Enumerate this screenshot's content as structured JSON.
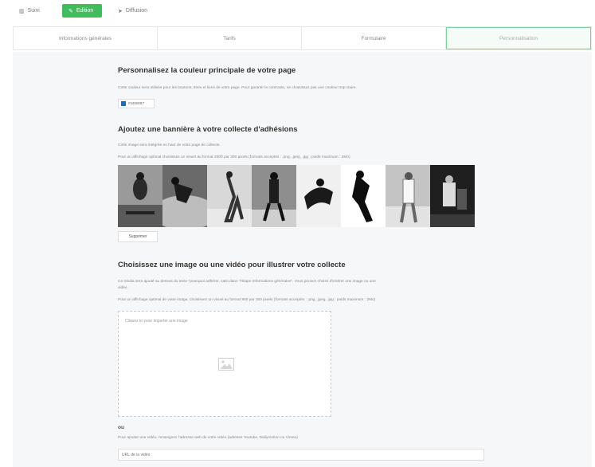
{
  "nav": {
    "suivi": {
      "icon": "chart-icon",
      "label": "Suivi"
    },
    "edition": {
      "icon": "pencil-icon",
      "label": "Edition"
    },
    "diffusion": {
      "icon": "send-icon",
      "label": "Diffusion"
    }
  },
  "tabs": [
    {
      "label": "Informations générales"
    },
    {
      "label": "Tarifs"
    },
    {
      "label": "Formulaire"
    },
    {
      "label": "Personnalisation"
    }
  ],
  "color_section": {
    "title": "Personnalisez la couleur principale de votre page",
    "description": "Cette couleur sera utilisée pour les boutons, titres et liens de votre page. Pour garantir le contraste, ne choisissez pas une couleur trop claire.",
    "color_value": "#1E6EB7",
    "color_hex": "#1e6fb8"
  },
  "banner_section": {
    "title": "Ajoutez une bannière à votre collecte d'adhésions",
    "description": "Cette image sera intégrée en haut de votre page de collecte.",
    "hint": "Pour un affichage optimal choisissez un visuel au format 2000 par 300 pixels (formats acceptés : .png, .jpeg, .jpg ; poids maximum : 2Mo)",
    "delete_label": "Supprimer"
  },
  "media_section": {
    "title": "Choisissez une image ou une vidéo pour illustrer votre collecte",
    "description_line1": "Ce média sera ajouté au dessus du texte \"pourquoi adhérer, saisi dans \"l'étape informations générales\". Vous pouvez choisir d'insérer une image ou une",
    "description_line2": "vidéo.",
    "hint": "Pour un affichage optimal de votre image, choisissez un visuel au format 800 par 300 pixels (formats acceptés : .png, .jpeg, .jpg ; poids maximum : 2Mo)",
    "upload_text": "Cliquez ici pour importer une image",
    "upload_icon": "image-placeholder-icon",
    "or_label": "ou",
    "video_hint": "Pour ajouter une vidéo, renseignez l'adresse web de votre vidéo (adresse Youtube, Dailymotion ou Vimeo)",
    "url_placeholder": "URL de la vidéo"
  }
}
